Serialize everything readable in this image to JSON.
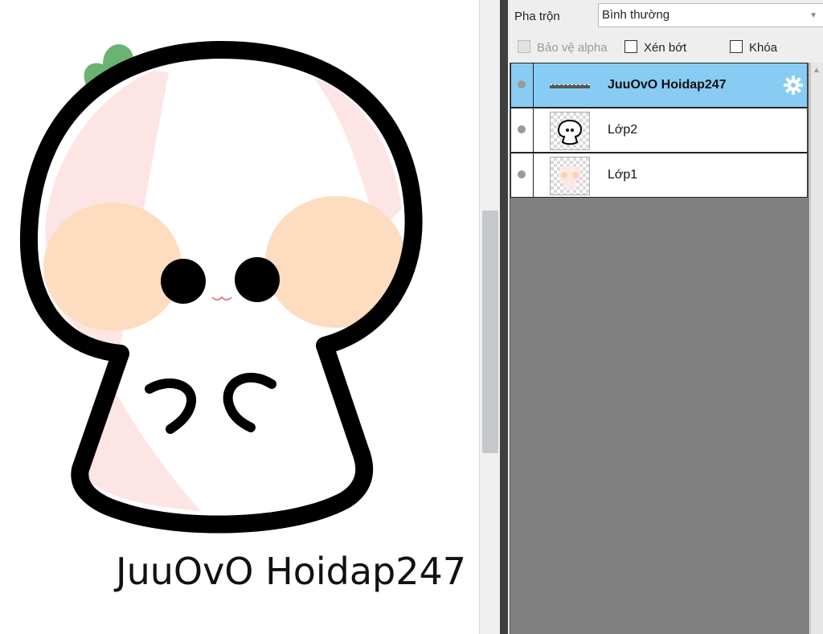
{
  "canvas": {
    "text": "JuuOvO Hoidap247",
    "colors": {
      "outline": "#000000",
      "cheek": "#fddcc0",
      "shade": "#fde5e5",
      "leaf": "#6ab372"
    }
  },
  "panel": {
    "blend_label": "Pha trộn",
    "blend_value": "Bình thường",
    "options": {
      "protect_alpha": "Bảo vệ alpha",
      "clipping": "Xén bớt",
      "lock": "Khóa"
    },
    "layers": [
      {
        "name": "JuuOvO Hoidap247",
        "selected": true,
        "thumb_icon": "text-layer-icon"
      },
      {
        "name": "Lớp2",
        "selected": false
      },
      {
        "name": "Lớp1",
        "selected": false
      }
    ],
    "accent": "#89ccf3"
  }
}
